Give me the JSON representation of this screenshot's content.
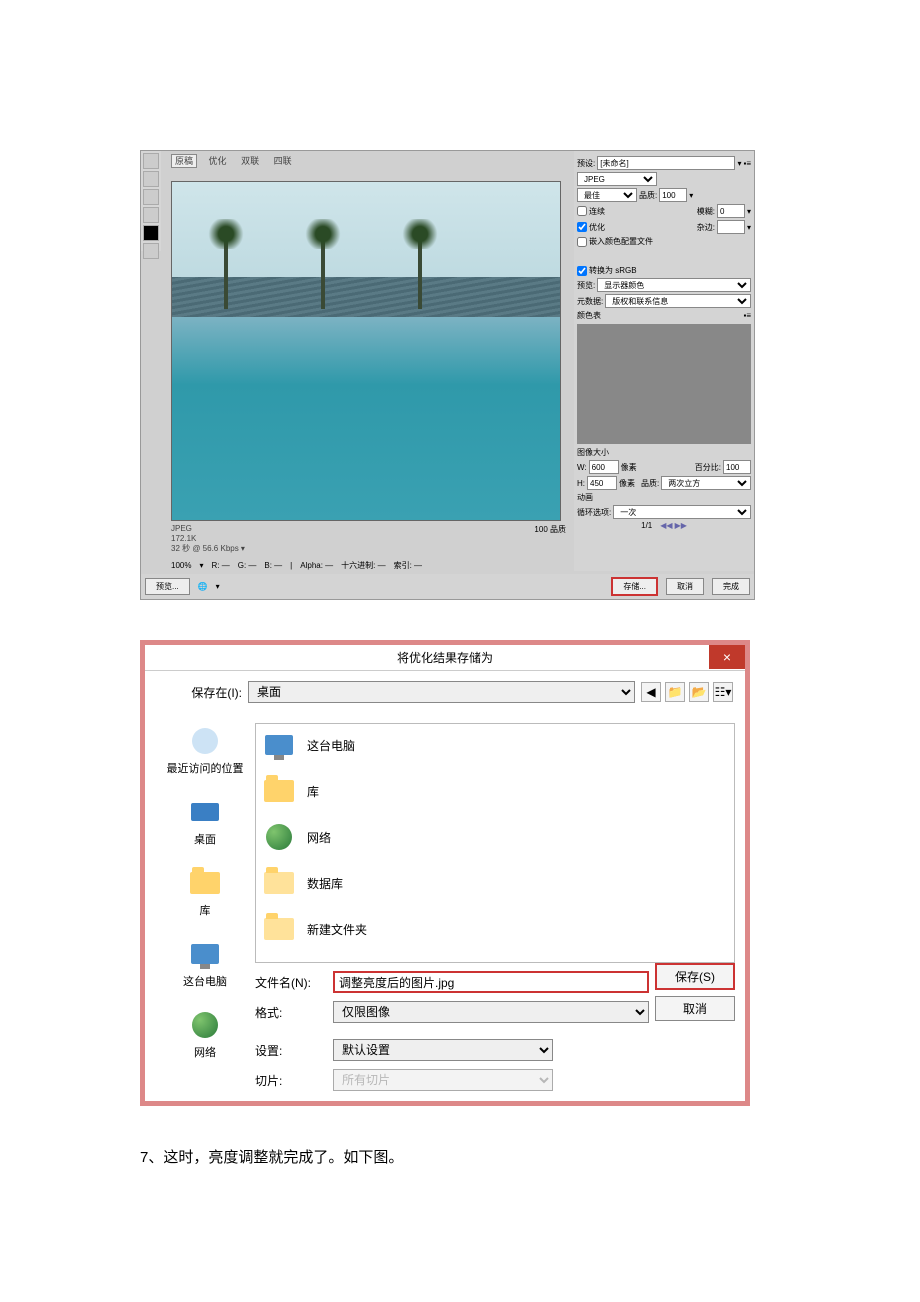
{
  "sfw": {
    "tabs": {
      "original": "原稿",
      "optimized": "优化",
      "two": "双联",
      "four": "四联"
    },
    "info": {
      "format": "JPEG",
      "size": "172.1K",
      "speed": "32 秒 @ 56.6 Kbps  ▾"
    },
    "quality_text": "100 品质",
    "zoom_row": {
      "zoom": "100%",
      "r": "R: —",
      "g": "G: —",
      "b": "B: —",
      "alpha": "Alpha: —",
      "hex": "十六进制: —",
      "index": "索引: —"
    },
    "right": {
      "preset_label": "预设:",
      "preset": "[未命名]",
      "format": "JPEG",
      "quality_preset": "最佳",
      "quality_label": "品质:",
      "quality": "100",
      "progressive": "连续",
      "blur_label": "模糊:",
      "blur": "0",
      "optimize": "优化",
      "matte_label": "杂边:",
      "embed": "嵌入颜色配置文件",
      "convert": "转换为 sRGB",
      "preview_label": "预览:",
      "preview": "显示器颜色",
      "metadata_label": "元数据:",
      "metadata": "版权和联系信息",
      "color_table": "颜色表",
      "image_size": "图像大小",
      "w_label": "W:",
      "w": "600",
      "h_label": "H:",
      "h": "450",
      "px": "像素",
      "percent_label": "百分比:",
      "percent": "100",
      "resample_label": "品质:",
      "resample": "两次立方",
      "anim": "动画",
      "loop_label": "循环选项:",
      "loop": "一次",
      "frame": "1/1"
    },
    "bottom": {
      "preview": "预览...",
      "save": "存储...",
      "cancel": "取消",
      "done": "完成"
    }
  },
  "saveas": {
    "title": "将优化结果存储为",
    "close": "×",
    "savein_label": "保存在(I):",
    "savein": "桌面",
    "places": {
      "recent": "最近访问的位置",
      "desktop": "桌面",
      "library": "库",
      "computer": "这台电脑",
      "network": "网络"
    },
    "items": {
      "computer": "这台电脑",
      "library": "库",
      "network": "网络",
      "database": "数据库",
      "newfolder": "新建文件夹"
    },
    "filename_label": "文件名(N):",
    "filename": "调整亮度后的图片.jpg",
    "format_label": "格式:",
    "format": "仅限图像",
    "settings_label": "设置:",
    "settings": "默认设置",
    "slices_label": "切片:",
    "slices": "所有切片",
    "save_btn": "保存(S)",
    "cancel_btn": "取消"
  },
  "caption": "7、这时，亮度调整就完成了。如下图。"
}
